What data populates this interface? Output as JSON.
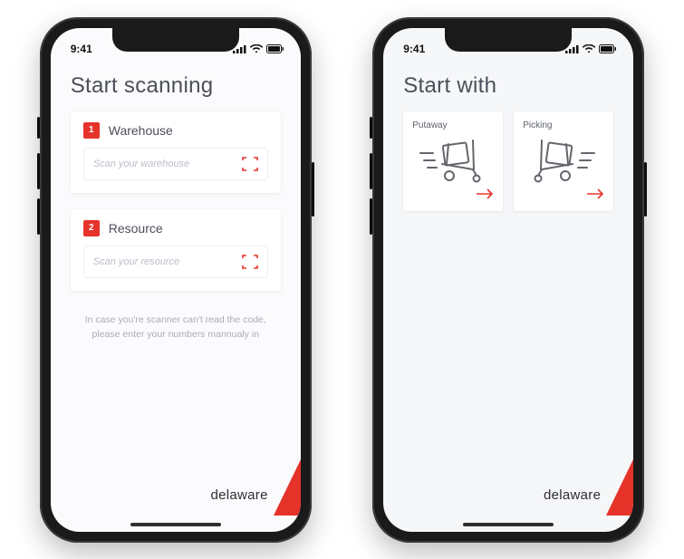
{
  "status": {
    "time": "9:41"
  },
  "screen1": {
    "title": "Start scanning",
    "cards": [
      {
        "num": "1",
        "label": "Warehouse",
        "placeholder": "Scan your warehouse"
      },
      {
        "num": "2",
        "label": "Resource",
        "placeholder": "Scan your resource"
      }
    ],
    "helper_line1": "In case you're scanner can't read the code,",
    "helper_line2": "please enter your numbers mannualy in"
  },
  "screen2": {
    "title": "Start with",
    "tiles": [
      {
        "label": "Putaway"
      },
      {
        "label": "Picking"
      }
    ]
  },
  "brand": {
    "name": "delaware"
  },
  "colors": {
    "accent": "#e5332a"
  }
}
